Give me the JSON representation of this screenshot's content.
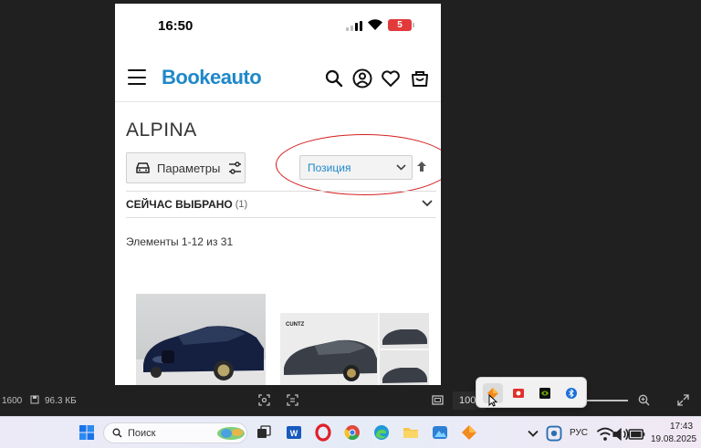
{
  "phone": {
    "status": {
      "time": "16:50",
      "battery": "5"
    },
    "header": {
      "logo": "Bookeauto"
    },
    "category": {
      "title": "ALPINA",
      "filters_label": "Параметры",
      "sort_value": "Позиция",
      "selected_title": "СЕЙЧАС ВЫБРАНО",
      "selected_count": "(1)",
      "results": "Элементы 1-12 из 31"
    },
    "products": [
      {
        "image_text": ""
      },
      {
        "image_text": "CUNTZ"
      }
    ]
  },
  "viewer": {
    "resolution_partial": "1600",
    "file_size": "96.3 КБ",
    "zoom": "100"
  },
  "taskbar": {
    "search_placeholder": "Поиск",
    "language": "РУС",
    "time": "17:43",
    "date": "19.08.2025"
  },
  "colors": {
    "brand": "#1e88c9",
    "annotation": "#d42020",
    "battery": "#e23a3a"
  }
}
